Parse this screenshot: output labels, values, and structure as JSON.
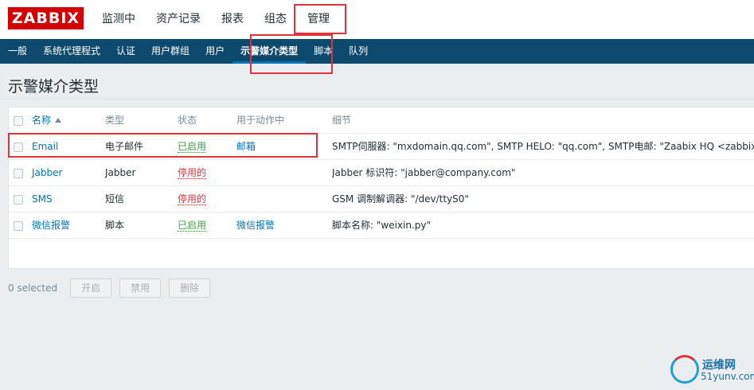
{
  "logo": "ZABBIX",
  "top_menu": [
    "监测中",
    "资产记录",
    "报表",
    "组态",
    "管理"
  ],
  "sub_menu": [
    "一般",
    "系统代理程式",
    "认证",
    "用户群组",
    "用户",
    "示警媒介类型",
    "脚本",
    "队列"
  ],
  "page_title": "示警媒介类型",
  "table": {
    "headers": {
      "name": "名称",
      "type": "类型",
      "status": "状态",
      "actions": "用于动作中",
      "details": "细节"
    },
    "rows": [
      {
        "name": "Email",
        "type": "电子邮件",
        "status": "已启用",
        "actions": "邮箱",
        "details": "SMTP伺服器: \"mxdomain.qq.com\", SMTP HELO: \"qq.com\", SMTP电邮: \"Zaabix HQ <zabbix@zabbi"
      },
      {
        "name": "Jabber",
        "type": "Jabber",
        "status": "停用的",
        "actions": "",
        "details": "Jabber 标识符: \"jabber@company.com\""
      },
      {
        "name": "SMS",
        "type": "短信",
        "status": "停用的",
        "actions": "",
        "details": "GSM 调制解调器: \"/dev/ttyS0\""
      },
      {
        "name": "微信报警",
        "type": "脚本",
        "status": "已启用",
        "actions": "微信报警",
        "details": "脚本名称: \"weixin.py\""
      }
    ]
  },
  "footer": {
    "selected": "0 selected",
    "enable_label": "开启",
    "disable_label": "禁用",
    "delete_label": "删除"
  },
  "watermark": {
    "line1": "运维网",
    "line2": "51yunv.com"
  },
  "colors": {
    "brand_red": "#d40000",
    "nav_blue": "#0e4a6e",
    "link_blue": "#0275b8",
    "enabled_green": "#429e47",
    "disabled_red": "#e0323a",
    "highlight_red": "#e0323a"
  }
}
